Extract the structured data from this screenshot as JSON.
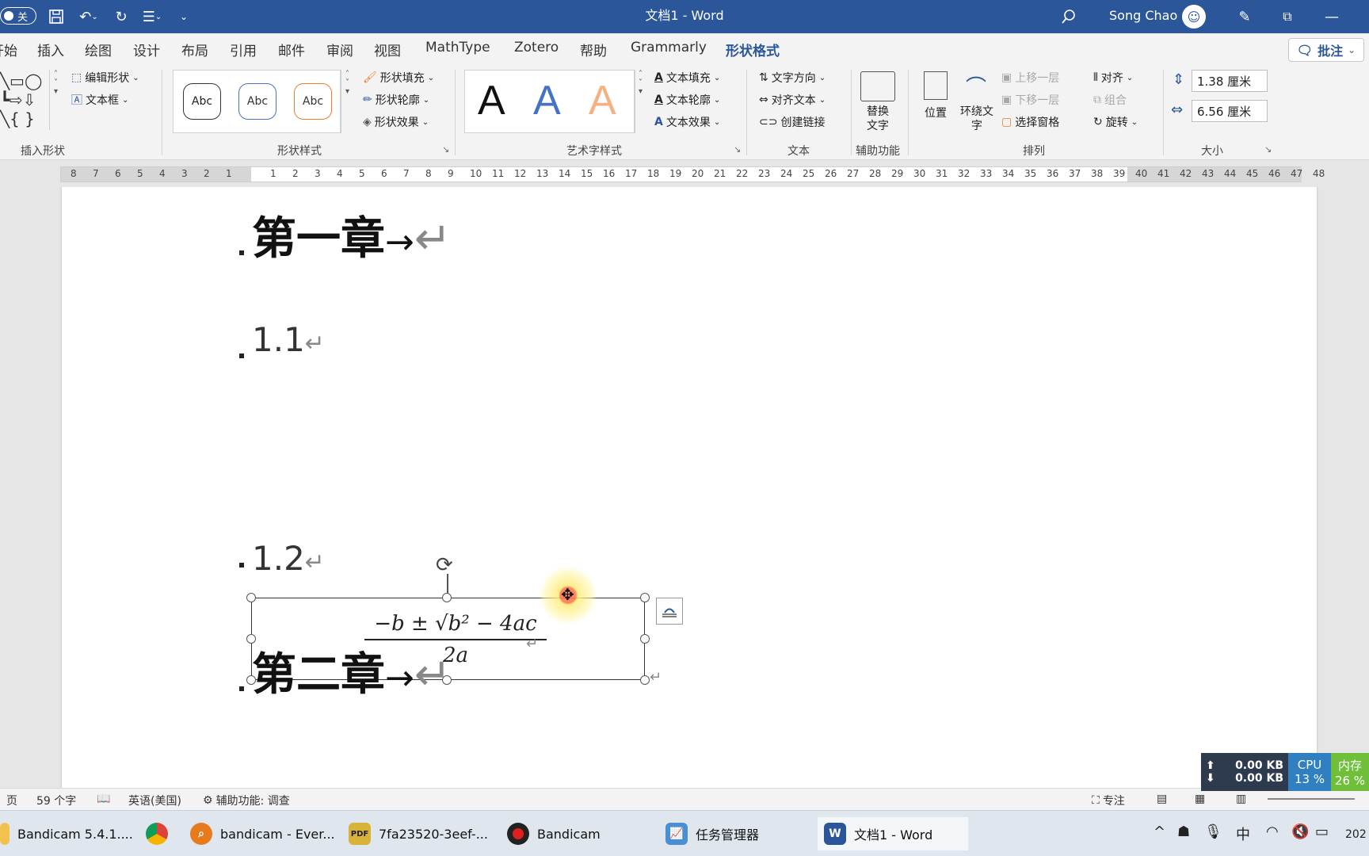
{
  "titlebar": {
    "toggle_label": "关",
    "doc_title": "文档1 - Word",
    "user_name": "Song Chao",
    "accent": "#2b579a"
  },
  "tabs": [
    {
      "label": "开始"
    },
    {
      "label": "插入"
    },
    {
      "label": "绘图"
    },
    {
      "label": "设计"
    },
    {
      "label": "布局"
    },
    {
      "label": "引用"
    },
    {
      "label": "邮件"
    },
    {
      "label": "审阅"
    },
    {
      "label": "视图"
    },
    {
      "label": "MathType"
    },
    {
      "label": "Zotero"
    },
    {
      "label": "帮助"
    },
    {
      "label": "Grammarly"
    },
    {
      "label": "形状格式"
    }
  ],
  "comment_btn": "批注",
  "ribbon": {
    "insert_shapes": {
      "edit_shape": "编辑形状",
      "textbox": "文本框",
      "label": "插入形状"
    },
    "shape_styles": {
      "abc": "Abc",
      "fill": "形状填充",
      "outline": "形状轮廓",
      "effects": "形状效果",
      "label": "形状样式"
    },
    "wordart": {
      "letter": "A",
      "text_fill": "文本填充",
      "text_outline": "文本轮廓",
      "text_effects": "文本效果",
      "label": "艺术字样式"
    },
    "text": {
      "direction": "文字方向",
      "align": "对齐文本",
      "link": "创建链接",
      "label": "文本"
    },
    "accessibility": {
      "alt_text_1": "替换",
      "alt_text_2": "文字",
      "label": "辅助功能"
    },
    "arrange": {
      "position": "位置",
      "wrap_1": "环绕文",
      "wrap_2": "字",
      "bring_forward": "上移一层",
      "send_backward": "下移一层",
      "selection_pane": "选择窗格",
      "align": "对齐",
      "group": "组合",
      "rotate": "旋转",
      "label": "排列"
    },
    "size": {
      "height": "1.38 厘米",
      "width": "6.56 厘米",
      "label": "大小"
    }
  },
  "ruler": {
    "left_nums": [
      "8",
      "7",
      "6",
      "5",
      "4",
      "3",
      "2",
      "1"
    ],
    "right_nums": [
      "1",
      "2",
      "3",
      "4",
      "5",
      "6",
      "7",
      "8",
      "9",
      "10",
      "11",
      "12",
      "13",
      "14",
      "15",
      "16",
      "17",
      "18",
      "19",
      "20",
      "21",
      "22",
      "23",
      "24",
      "25",
      "26",
      "27",
      "28",
      "29",
      "30",
      "31",
      "32",
      "33",
      "34",
      "35",
      "36",
      "37",
      "38",
      "39",
      "40",
      "41",
      "42",
      "43",
      "44",
      "45",
      "46",
      "47",
      "48"
    ]
  },
  "document": {
    "h1": "第一章",
    "s1": "1.1",
    "equation_num": "−b ± √b² − 4ac",
    "equation_den": "2a",
    "s2": "1.2",
    "h2": "第二章",
    "arrow": "→",
    "para": "↵"
  },
  "netmon": {
    "up": "0.00 KB",
    "down": "0.00 KB",
    "cpu_label": "CPU",
    "cpu": "13 %",
    "mem_label": "内存",
    "mem": "26 %"
  },
  "statusbar": {
    "page": "页",
    "words": "59 个字",
    "lang": "英语(美国)",
    "access": "辅助功能: 调查",
    "focus": "专注"
  },
  "taskbar": [
    {
      "label": "Bandicam 5.4.1...."
    },
    {
      "label": "bandicam - Ever..."
    },
    {
      "label": "7fa23520-3eef-..."
    },
    {
      "label": "Bandicam"
    },
    {
      "label": "任务管理器"
    },
    {
      "label": "文档1 - Word"
    }
  ],
  "tray": {
    "ime": "中",
    "clock": "202"
  }
}
